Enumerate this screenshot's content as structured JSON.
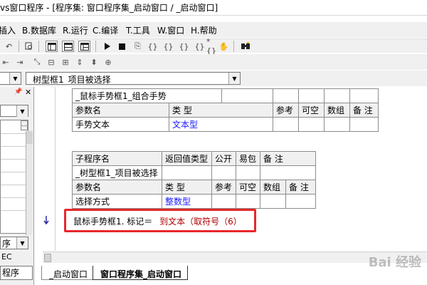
{
  "window": {
    "title": "vs窗口程序 - [程序集: 窗口程序集_启动窗口 / _启动窗口]"
  },
  "menu": {
    "items": [
      {
        "label": "插入"
      },
      {
        "label": "B.数据库"
      },
      {
        "label": "R.运行"
      },
      {
        "label": "C.编译"
      },
      {
        "label": "T.工具"
      },
      {
        "label": "W.窗口"
      },
      {
        "label": "H.帮助"
      }
    ]
  },
  "combo": {
    "left_value": "",
    "right_value": "_树型框1_项目被选择"
  },
  "left_panel": {
    "close_label": "✕",
    "pin_label": "📌",
    "bottom_labels": [
      "序",
      "EC",
      "程序"
    ]
  },
  "table1": {
    "sub_name": "_鼠标手势框1_组合手势",
    "header": [
      "参数名",
      "类  型",
      "参考",
      "可空",
      "数组",
      "备  注"
    ],
    "row": [
      "手势文本",
      "文本型"
    ]
  },
  "table2": {
    "header": [
      "子程序名",
      "返回值类型",
      "公开",
      "易包",
      "备  注"
    ],
    "sub_name": "_树型框1_项目被选择",
    "param_header": [
      "参数名",
      "类  型",
      "参考",
      "可空",
      "数组",
      "备  注"
    ],
    "row": [
      "选择方式",
      "整数型"
    ]
  },
  "code_line": {
    "left": "鼠标手势框1. 标记＝",
    "right": "到文本（取符号（6）"
  },
  "tabs": [
    {
      "label": "_启动窗口"
    },
    {
      "label": "窗口程序集_启动窗口"
    }
  ],
  "watermark": "Bai 经验",
  "colors": {
    "highlight": "#e8272b",
    "type_blue": "#1a1aff",
    "code_red": "#b00000"
  }
}
